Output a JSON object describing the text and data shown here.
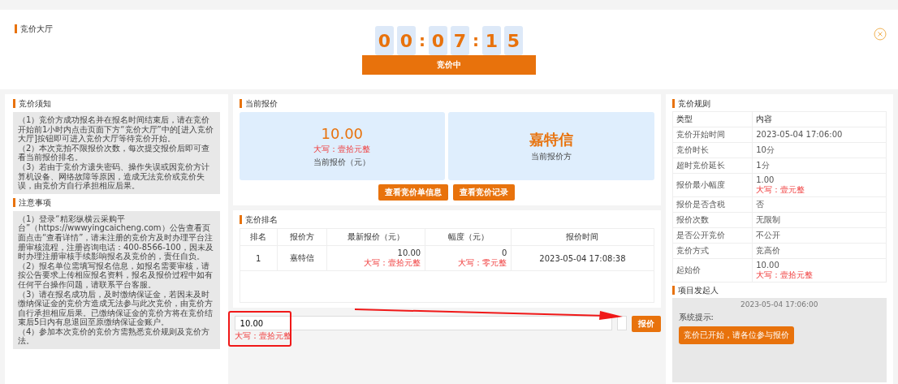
{
  "page_title": "竞价大厅",
  "countdown": {
    "cells": [
      {
        "kind": "digit",
        "text": "0"
      },
      {
        "kind": "digit",
        "text": "0"
      },
      {
        "kind": "separator",
        "text": ":"
      },
      {
        "kind": "digit",
        "text": "0"
      },
      {
        "kind": "digit",
        "text": "7"
      },
      {
        "kind": "separator",
        "text": ":"
      },
      {
        "kind": "digit",
        "text": "1"
      },
      {
        "kind": "digit",
        "text": "5"
      }
    ],
    "status": "竞价中"
  },
  "bid_notice": {
    "title": "竞价须知",
    "paragraphs": [
      "（1）竞价方成功报名并在报名时间结束后，请在竞价开始前1小时内点击页面下方“竞价大厅”中的[进入竞价大厅]按钮即可进入竞价大厅等待竞价开始。",
      "（2）本次竞拍不限报价次数，每次提交报价后即可查看当前报价排名。",
      "（3）若由于竞价方遗失密码、操作失误或因竞价方计算机设备、网络故障等原因，造成无法竞价或竞价失误，由竞价方自行承担相应后果。"
    ]
  },
  "precautions": {
    "title": "注意事项",
    "paragraphs": [
      "（1）登录“精彩纵横云采购平台”（https://wwwyingcaicheng.com）公告查看页面点击“查看详情”，请未注册的竞价方及时办理平台注册审核流程，注册咨询电话：400-8566-100，因未及时办理注册审核手续影响报名及竞价的，责任自负。",
      "（2）报名单位需填写报名信息，如报名需要审核，请按公告要求上传相应报名资料，报名及报价过程中如有任何平台操作问题，请联系平台客服。",
      "（3）请在报名成功后，及时缴纳保证金，若因未及时缴纳保证金的竞价方造成无法参与此次竞价，由竞价方自行承担相应后果。已缴纳保证金的竞价方将在竞价结束后5日内有息退回至原缴纳保证金账户。",
      "（4）参加本次竞价的竞价方需熟悉竞价规则及竞价方法。"
    ]
  },
  "current_bid": {
    "title": "当前报价",
    "price": "10.00",
    "price_words": "大写：壹拾元整",
    "price_label": "当前报价（元）",
    "bidder": "嘉特信",
    "bidder_label": "当前报价方",
    "buttons": [
      "查看竞价单信息",
      "查看竞价记录"
    ]
  },
  "ranking": {
    "title": "竞价排名",
    "columns": [
      "排名",
      "报价方",
      "最新报价（元）",
      "幅度（元）",
      "报价时间"
    ],
    "rows": [
      {
        "rank": "1",
        "bidder": "嘉特信",
        "price": "10.00",
        "price_words": "大写：壹拾元整",
        "step": "0",
        "step_words": "大写：零元整",
        "time": "2023-05-04 17:08:38"
      }
    ]
  },
  "bid_input": {
    "value": "10.00",
    "words": "大写：壹拾元整",
    "button": "报价"
  },
  "rules": {
    "title": "竞价规则",
    "columns": [
      "类型",
      "内容"
    ],
    "rows": [
      {
        "type": "竞价开始时间",
        "content": "2023-05-04 17:06:00"
      },
      {
        "type": "竞价时长",
        "content": "10分"
      },
      {
        "type": "超时竞价延长",
        "content": "1分"
      },
      {
        "type": "报价最小幅度",
        "content": "1.00",
        "words": "大写：壹元整"
      },
      {
        "type": "报价是否含税",
        "content": "否"
      },
      {
        "type": "报价次数",
        "content": "无限制"
      },
      {
        "type": "是否公开竞价",
        "content": "不公开"
      },
      {
        "type": "竞价方式",
        "content": "竞高价"
      },
      {
        "type": "起始价",
        "content": "10.00",
        "words": "大写：壹拾元整"
      }
    ]
  },
  "initiator": {
    "title": "项目发起人",
    "time": "2023-05-04 17:06:00",
    "label": "系统提示:",
    "message": "竞价已开始，请各位参与报价"
  }
}
